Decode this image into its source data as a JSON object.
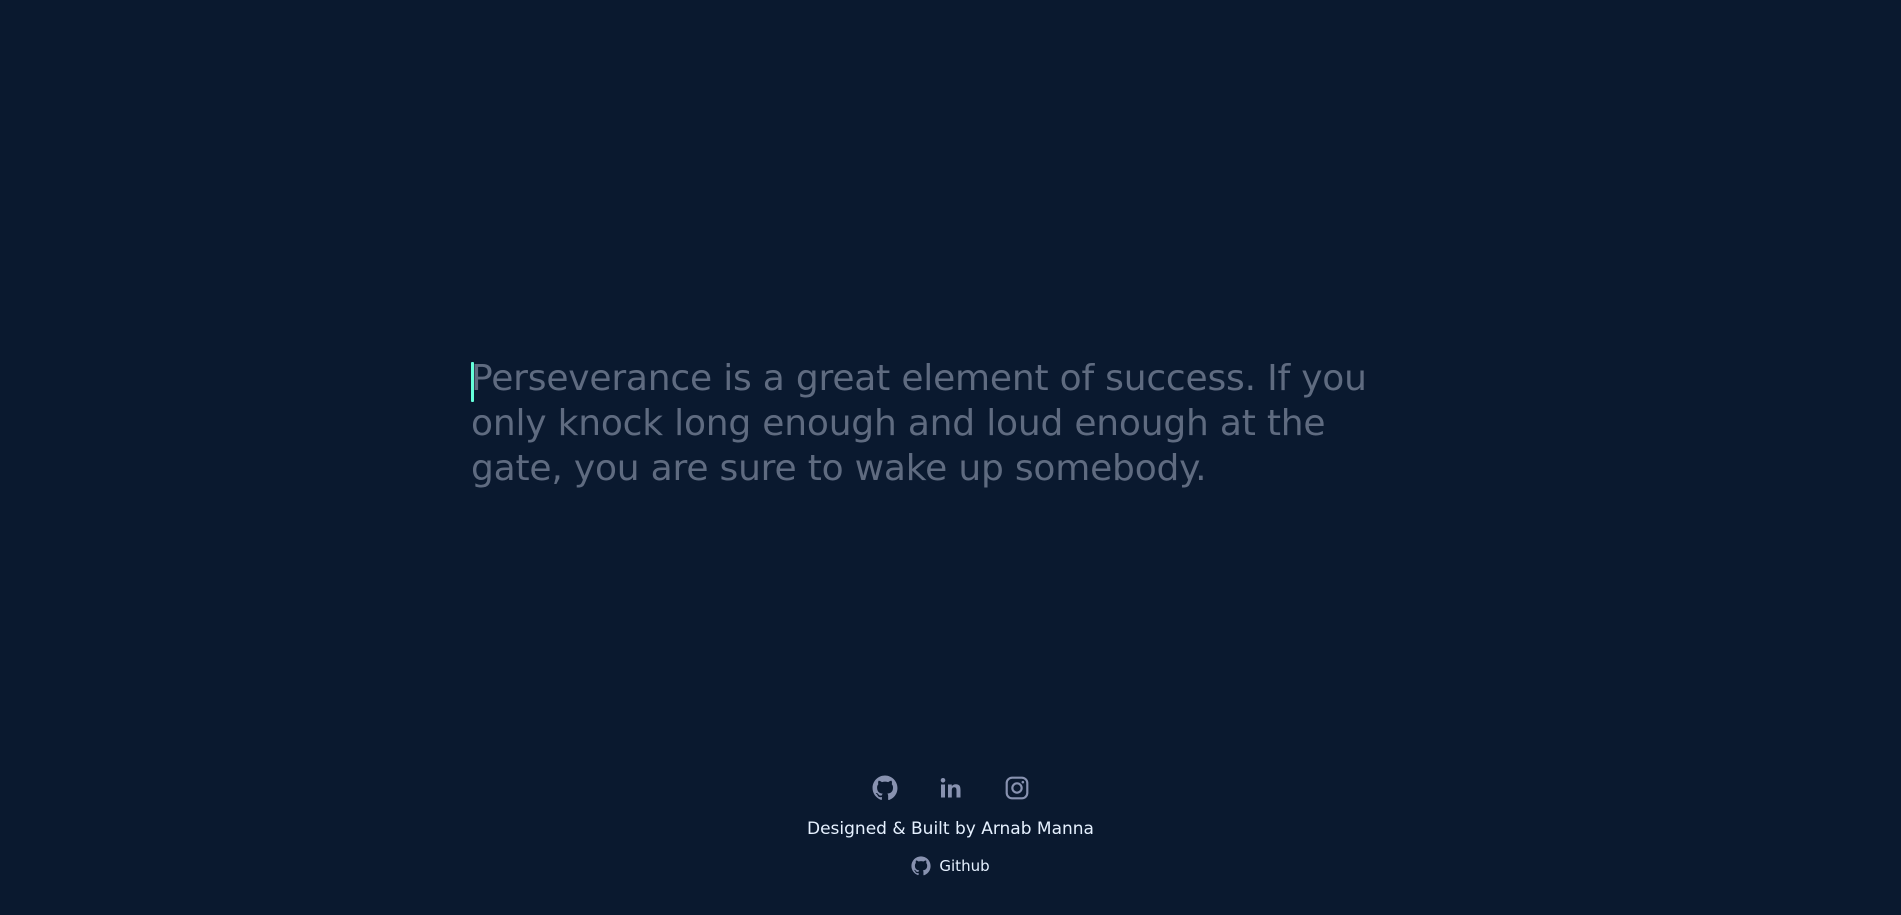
{
  "quote": {
    "text": "Perseverance is a great element of success. If you only knock long enough and loud enough at the gate, you are sure to wake up somebody."
  },
  "footer": {
    "social": [
      {
        "icon": "github-icon"
      },
      {
        "icon": "linkedin-icon"
      },
      {
        "icon": "instagram-icon"
      }
    ],
    "credit": "Designed & Built by Arnab Manna",
    "source_label": "Github"
  },
  "colors": {
    "background": "#0a192f",
    "quote_text": "#5f6b80",
    "caret": "#64ffda",
    "icon": "#8892b0",
    "footer_text": "#e6f1ff"
  }
}
